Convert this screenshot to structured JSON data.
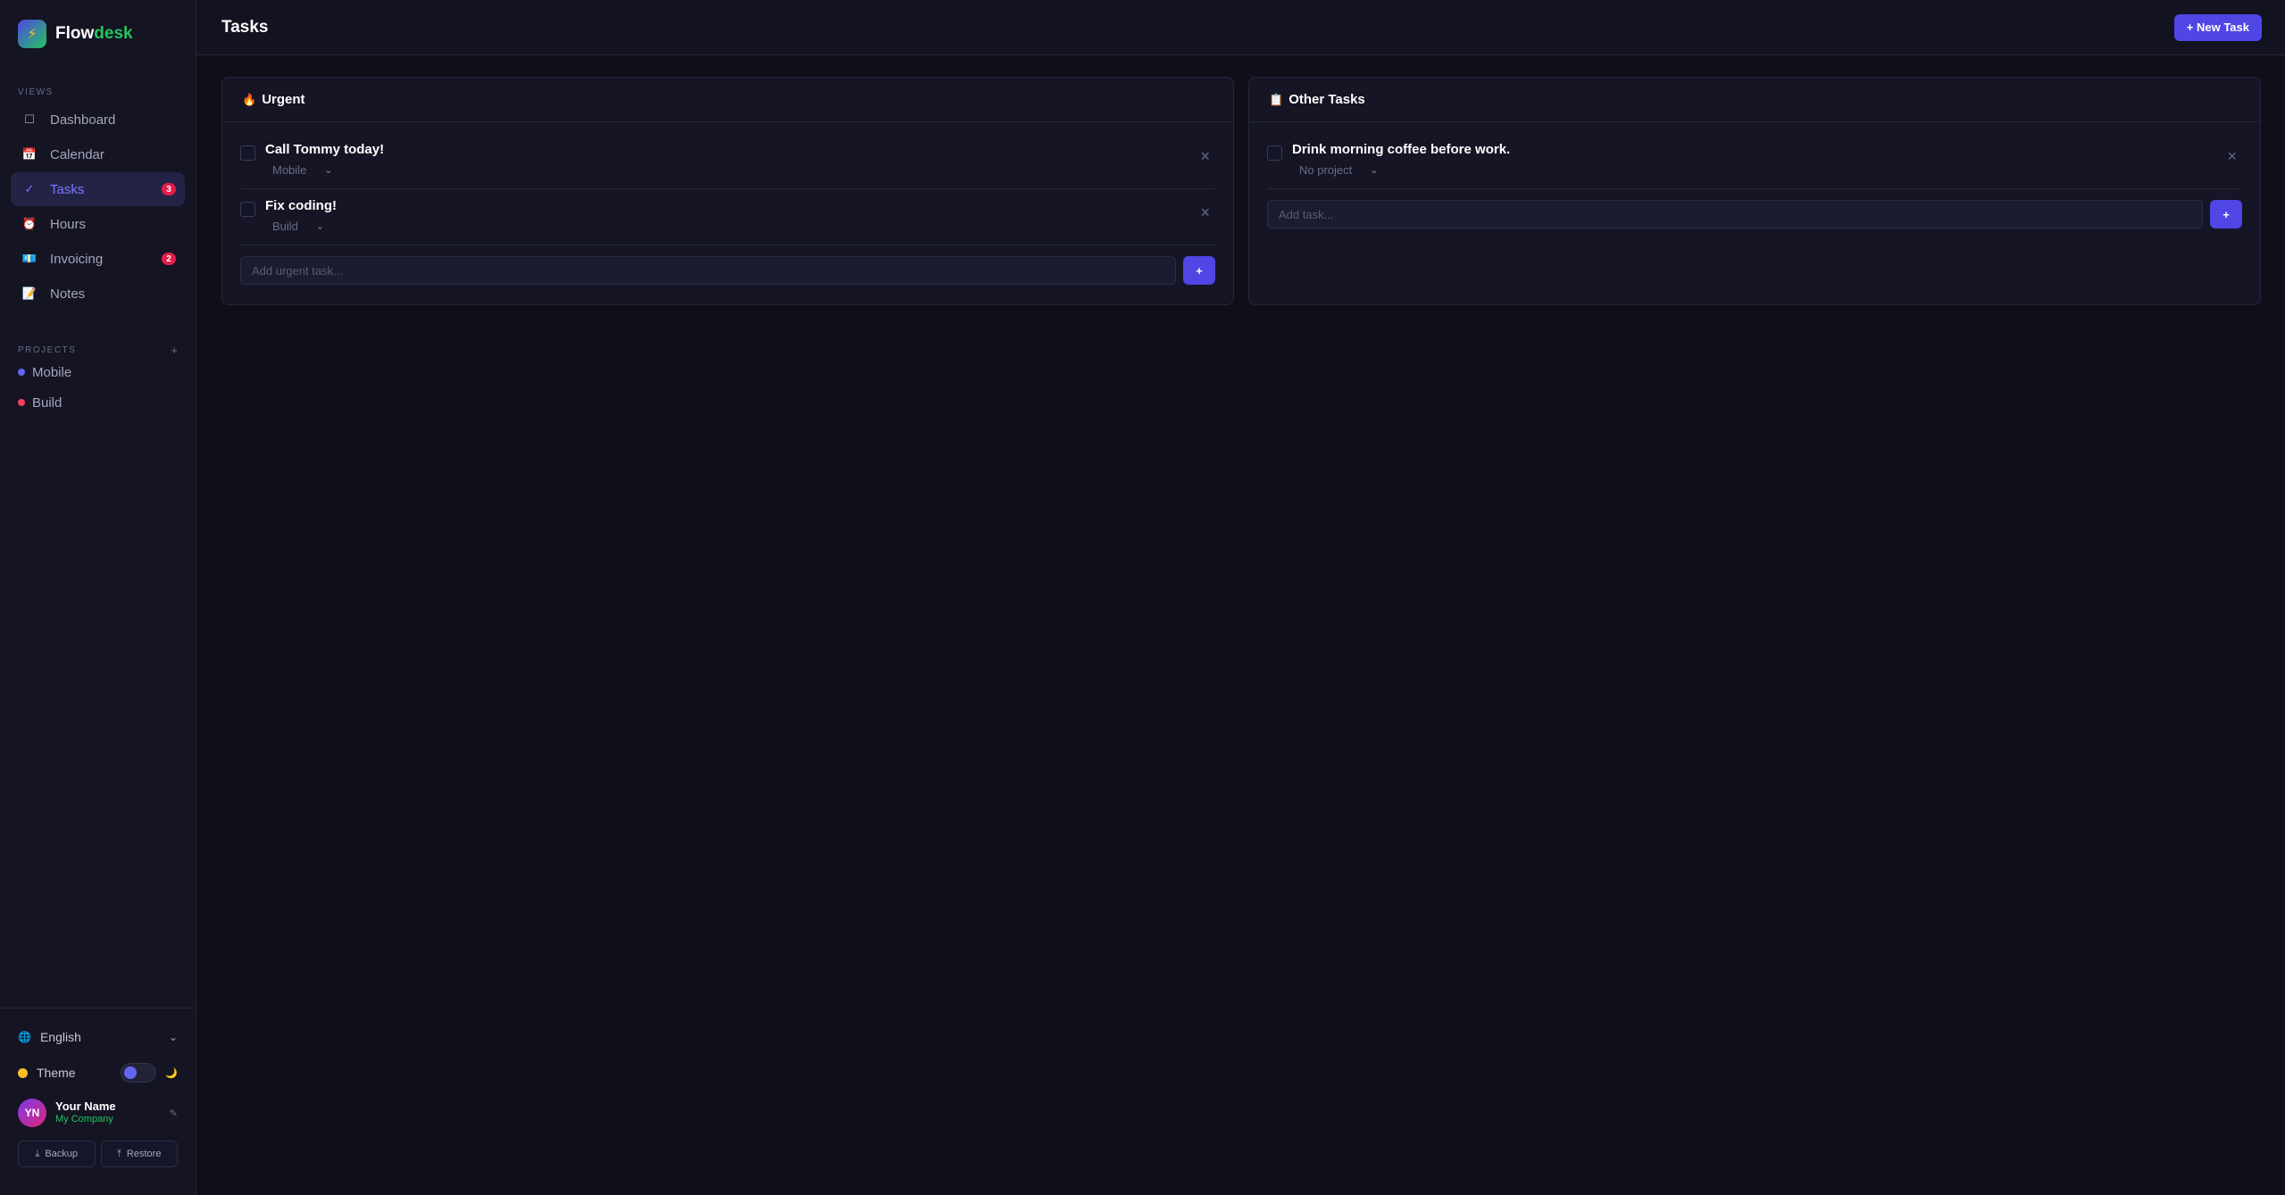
{
  "brand": {
    "part1": "Flow",
    "part2": "desk",
    "logo_icon": "⚡"
  },
  "sidebar": {
    "views_label": "VIEWS",
    "items": [
      {
        "label": "Dashboard",
        "icon": "☐",
        "badge": ""
      },
      {
        "label": "Calendar",
        "icon": "📅",
        "badge": ""
      },
      {
        "label": "Tasks",
        "icon": "✓",
        "badge": "3"
      },
      {
        "label": "Hours",
        "icon": "⏰",
        "badge": ""
      },
      {
        "label": "Invoicing",
        "icon": "💶",
        "badge": "2"
      },
      {
        "label": "Notes",
        "icon": "📝",
        "badge": ""
      }
    ],
    "projects_label": "PROJECTS",
    "projects_add": "+",
    "projects": [
      {
        "name": "Mobile",
        "color": "#6366f1"
      },
      {
        "name": "Build",
        "color": "#f43f5e"
      }
    ],
    "language": "English",
    "theme_label": "Theme",
    "user": {
      "initials": "YN",
      "name": "Your Name",
      "company": "My Company"
    },
    "backup_label": "Backup",
    "restore_label": "Restore"
  },
  "header": {
    "title": "Tasks",
    "new_task_label": "+ New Task"
  },
  "panels": {
    "urgent": {
      "title": "Urgent",
      "emoji": "🔥",
      "tasks": [
        {
          "title": "Call Tommy today!",
          "project": "Mobile"
        },
        {
          "title": "Fix coding!",
          "project": "Build"
        }
      ],
      "add_placeholder": "Add urgent task...",
      "add_button": "+"
    },
    "other": {
      "title": "Other Tasks",
      "emoji": "📋",
      "tasks": [
        {
          "title": "Drink morning coffee before work.",
          "project": "No project"
        }
      ],
      "add_placeholder": "Add task...",
      "add_button": "+"
    }
  },
  "colors": {
    "accent": "#4f46e5",
    "brand_green": "#22c55e",
    "badge_red": "#e11d48"
  }
}
